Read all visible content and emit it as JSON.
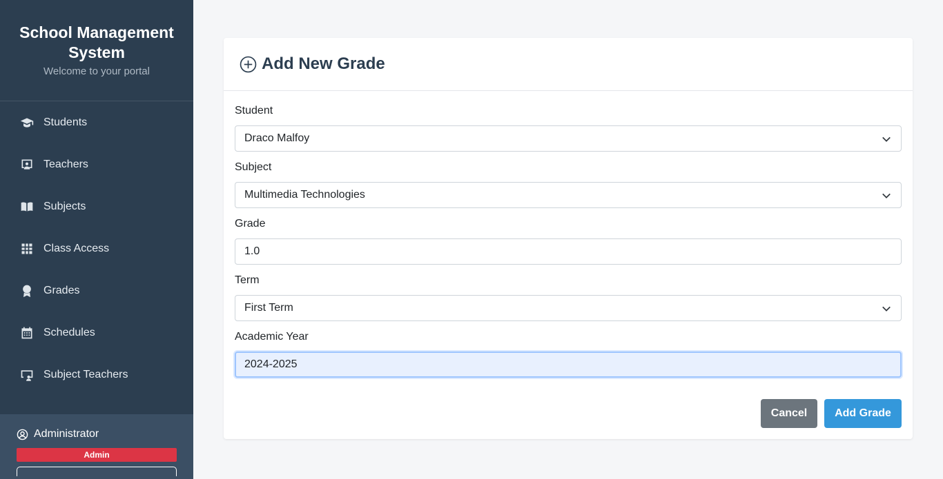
{
  "sidebar": {
    "title": "School Management System",
    "subtitle": "Welcome to your portal",
    "items": [
      {
        "label": "Students",
        "icon": "graduation-cap-icon"
      },
      {
        "label": "Teachers",
        "icon": "chalkboard-teacher-icon"
      },
      {
        "label": "Subjects",
        "icon": "book-open-icon"
      },
      {
        "label": "Class Access",
        "icon": "grid-icon"
      },
      {
        "label": "Grades",
        "icon": "award-icon"
      },
      {
        "label": "Schedules",
        "icon": "calendar-icon"
      },
      {
        "label": "Subject Teachers",
        "icon": "monitor-user-icon"
      }
    ],
    "user": {
      "name": "Administrator",
      "role": "Admin",
      "icon": "user-circle-icon"
    }
  },
  "form": {
    "title": "Add New Grade",
    "title_icon": "plus-circle-icon",
    "fields": {
      "student": {
        "label": "Student",
        "value": "Draco Malfoy"
      },
      "subject": {
        "label": "Subject",
        "value": "Multimedia Technologies"
      },
      "grade": {
        "label": "Grade",
        "value": "1.0"
      },
      "term": {
        "label": "Term",
        "value": "First Term"
      },
      "academic_year": {
        "label": "Academic Year",
        "value": "2024-2025"
      }
    },
    "buttons": {
      "cancel": "Cancel",
      "submit": "Add Grade"
    }
  },
  "colors": {
    "sidebar_bg": "#2c3e50",
    "user_box_bg": "#3b4f64",
    "admin_badge": "#dc3545",
    "primary": "#3498db",
    "secondary": "#6c757d"
  }
}
